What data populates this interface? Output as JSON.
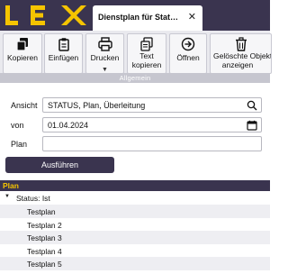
{
  "app": {
    "logo_text": "LEX",
    "brand_color": "#f5c400",
    "header_color": "#3a344f"
  },
  "tab": {
    "label": "Dienstplan für Status...",
    "close_icon": "close-icon"
  },
  "ribbon": {
    "buttons": [
      {
        "label": "Kopieren",
        "icon": "copy-icon"
      },
      {
        "label": "Einfügen",
        "icon": "paste-icon"
      },
      {
        "label": "Drucken",
        "icon": "print-icon"
      },
      {
        "label": "Text\nkopieren",
        "icon": "text-copy-icon"
      },
      {
        "label": "Öffnen",
        "icon": "open-icon"
      },
      {
        "label": "Gelöschte Objekte\nanzeigen",
        "icon": "trash-icon"
      }
    ],
    "group_label": "Allgemein"
  },
  "form": {
    "ansicht_label": "Ansicht",
    "ansicht_value": "STATUS, Plan, Überleitung",
    "von_label": "von",
    "von_value": "01.04.2024",
    "plan_label": "Plan",
    "plan_value": "",
    "run_button": "Ausführen"
  },
  "plan": {
    "title": "Plan",
    "group_label": "Status: Ist",
    "rows": [
      "Testplan",
      "Testplan 2",
      "Testplan 3",
      "Testplan 4",
      "Testplan 5"
    ]
  }
}
